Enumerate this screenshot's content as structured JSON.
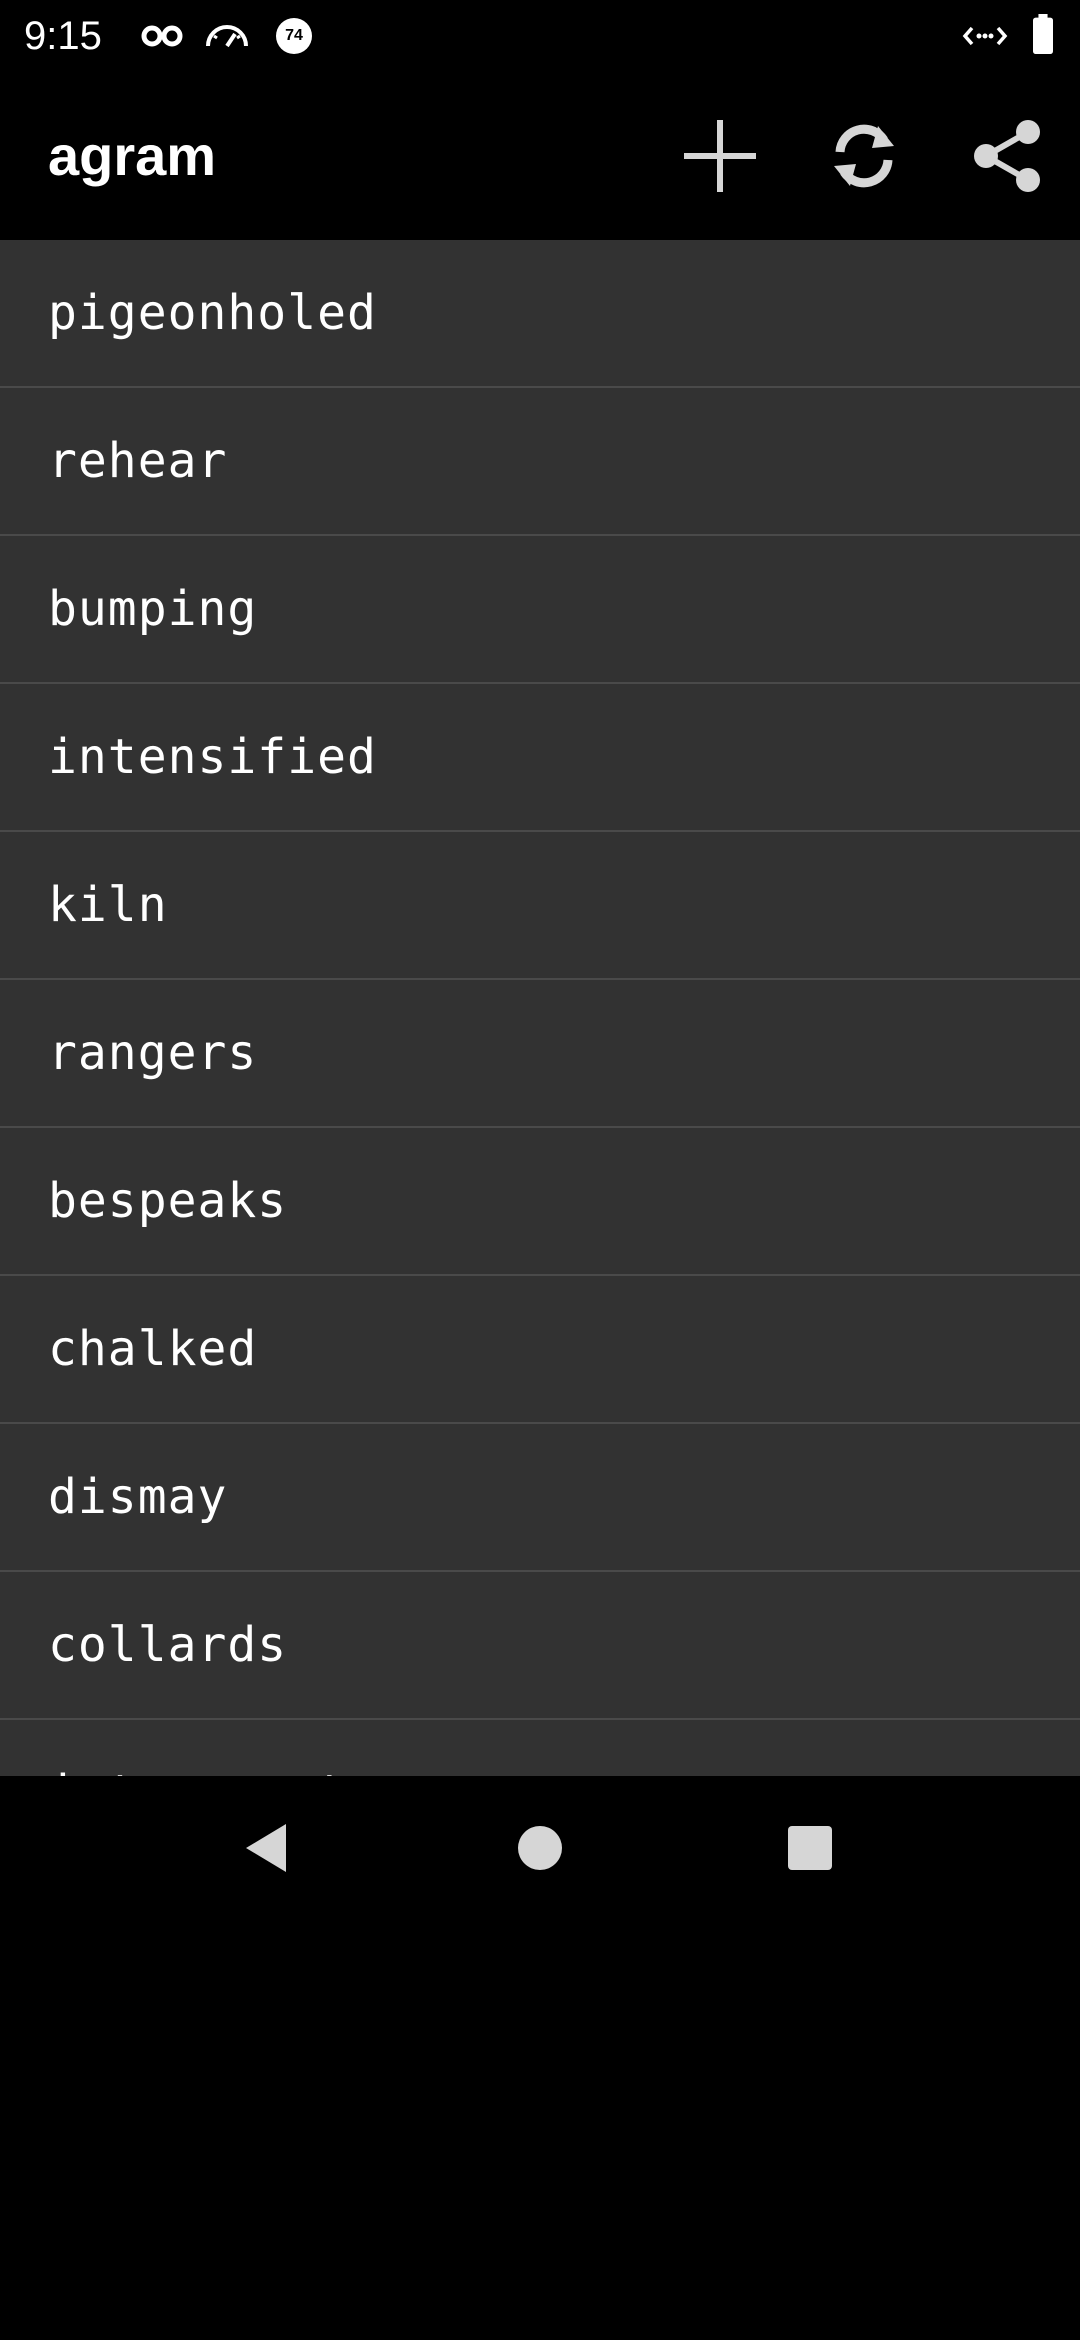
{
  "status_bar": {
    "time": "9:15",
    "icons_left": [
      "incognito-icon",
      "speedometer-icon",
      "notification-badge-icon"
    ],
    "badge_text": "74",
    "icons_right": [
      "data-sync-icon",
      "battery-icon"
    ]
  },
  "app_bar": {
    "title": "agram",
    "actions": [
      "add-icon",
      "refresh-icon",
      "share-icon"
    ]
  },
  "words": [
    "pigeonholed",
    "rehear",
    "bumping",
    "intensified",
    "kiln",
    "rangers",
    "bespeaks",
    "chalked",
    "dismay",
    "collards",
    "interrogates"
  ],
  "nav_bar": {
    "buttons": [
      "back-icon",
      "home-icon",
      "recents-icon"
    ]
  },
  "colors": {
    "list_background": "#323232",
    "divider": "#4a4a4a",
    "app_bar_background": "#000000",
    "text": "#ffffff",
    "icon": "#d6d6d6"
  }
}
